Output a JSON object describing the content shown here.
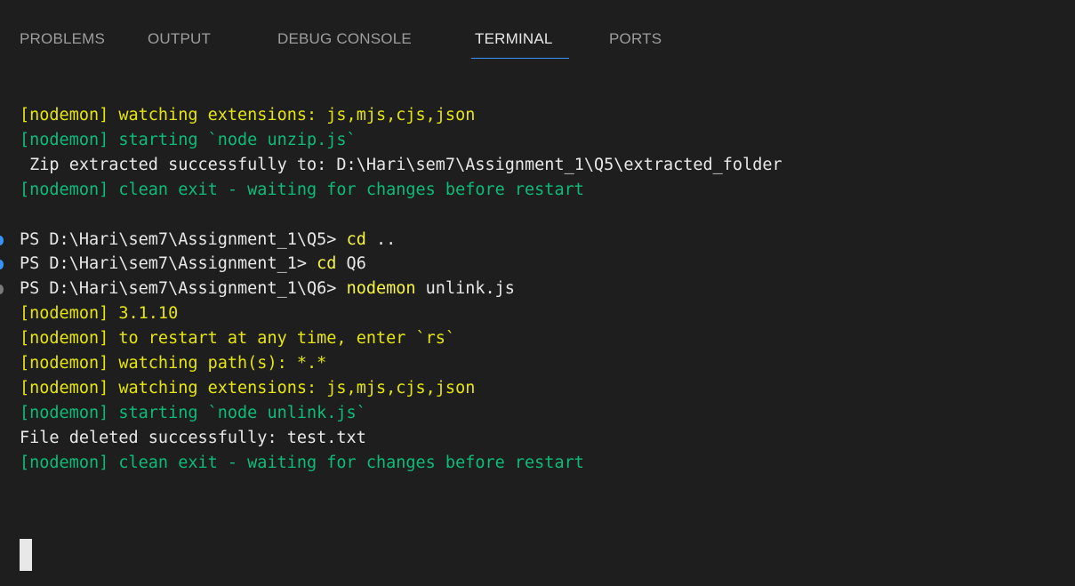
{
  "tabs": [
    {
      "label": "PROBLEMS",
      "active": false
    },
    {
      "label": "OUTPUT",
      "active": false
    },
    {
      "label": "DEBUG CONSOLE",
      "active": false
    },
    {
      "label": "TERMINAL",
      "active": true
    },
    {
      "label": "PORTS",
      "active": false
    }
  ],
  "terminal": {
    "lines": [
      {
        "text": "[nodemon] watching extensions: js,mjs,cjs,json",
        "color": "#e5e510"
      },
      {
        "text": "[nodemon] starting `node unzip.js`",
        "color": "#0dbc79"
      },
      {
        "text": " Zip extracted successfully to: D:\\Hari\\sem7\\Assignment_1\\Q5\\extracted_folder",
        "color": "#e8e8e8"
      },
      {
        "text": "[nodemon] clean exit - waiting for changes before restart",
        "color": "#0dbc79"
      },
      {
        "prompt": "PS D:\\Hari\\sem7\\Assignment_1\\Q5> ",
        "command": "cd",
        "args": " ..",
        "decoration": "blue"
      },
      {
        "prompt": "PS D:\\Hari\\sem7\\Assignment_1> ",
        "command": "cd",
        "args": " Q6",
        "decoration": "blue"
      },
      {
        "prompt": "PS D:\\Hari\\sem7\\Assignment_1\\Q6> ",
        "command": "nodemon",
        "args": " unlink.js",
        "decoration": "grey"
      },
      {
        "text": "[nodemon] 3.1.10",
        "color": "#e5e510"
      },
      {
        "text": "[nodemon] to restart at any time, enter `rs`",
        "color": "#e5e510"
      },
      {
        "text": "[nodemon] watching path(s): *.*",
        "color": "#e5e510"
      },
      {
        "text": "[nodemon] watching extensions: js,mjs,cjs,json",
        "color": "#e5e510"
      },
      {
        "text": "[nodemon] starting `node unlink.js`",
        "color": "#0dbc79"
      },
      {
        "text": "File deleted successfully: test.txt",
        "color": "#e8e8e8"
      },
      {
        "text": "[nodemon] clean exit - waiting for changes before restart",
        "color": "#0dbc79"
      }
    ]
  },
  "colors": {
    "background": "#1e1e1e",
    "tab_active_underline": "#3794ff",
    "nodemon_yellow": "#e5e510",
    "nodemon_green": "#0dbc79",
    "command_yellow": "#f5f543",
    "text_white": "#e8e8e8"
  }
}
